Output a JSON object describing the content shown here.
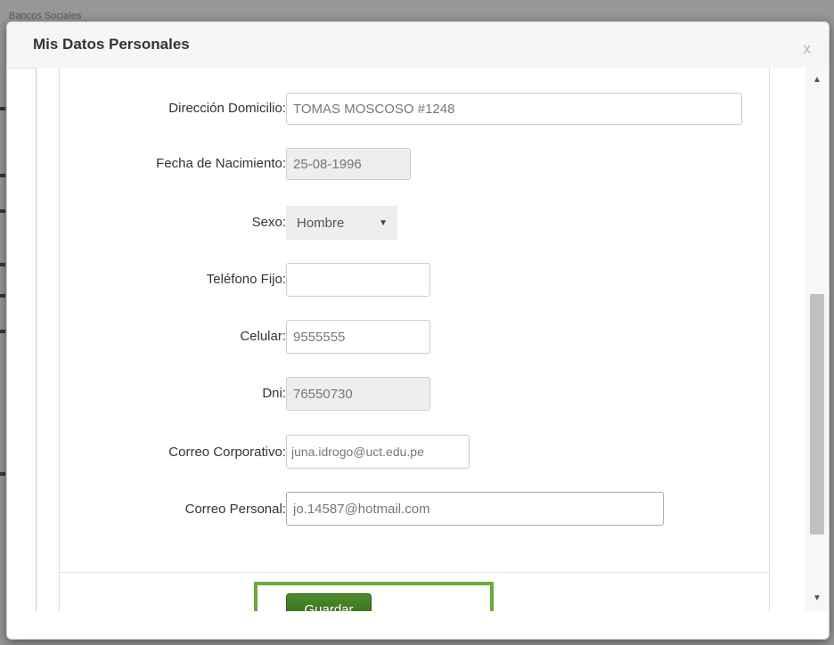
{
  "background": {
    "peek_text": "Bancos Sociales"
  },
  "modal": {
    "title": "Mis Datos Personales",
    "close_label": "x"
  },
  "form": {
    "direccion": {
      "label": "Dirección Domicilio:",
      "value": "TOMAS MOSCOSO #1248"
    },
    "fecha_nacimiento": {
      "label": "Fecha de Nacimiento:",
      "value": "25-08-1996"
    },
    "sexo": {
      "label": "Sexo:",
      "value": "Hombre"
    },
    "telefono_fijo": {
      "label": "Teléfono Fijo:",
      "value": ""
    },
    "celular": {
      "label": "Celular:",
      "value": "9555555"
    },
    "dni": {
      "label": "Dni:",
      "value": "76550730"
    },
    "correo_corporativo": {
      "label": "Correo Corporativo:",
      "value": "juna.idrogo@uct.edu.pe"
    },
    "correo_personal": {
      "label": "Correo Personal:",
      "value": "jo.14587@hotmail.com"
    },
    "save_label": "Guardar"
  },
  "colors": {
    "save_button": "#3d7a22",
    "highlight_box": "#6aab3c"
  },
  "icons": {
    "scroll_up": "triangle-up-icon",
    "scroll_down": "triangle-down-icon",
    "select_caret": "caret-down-icon"
  }
}
